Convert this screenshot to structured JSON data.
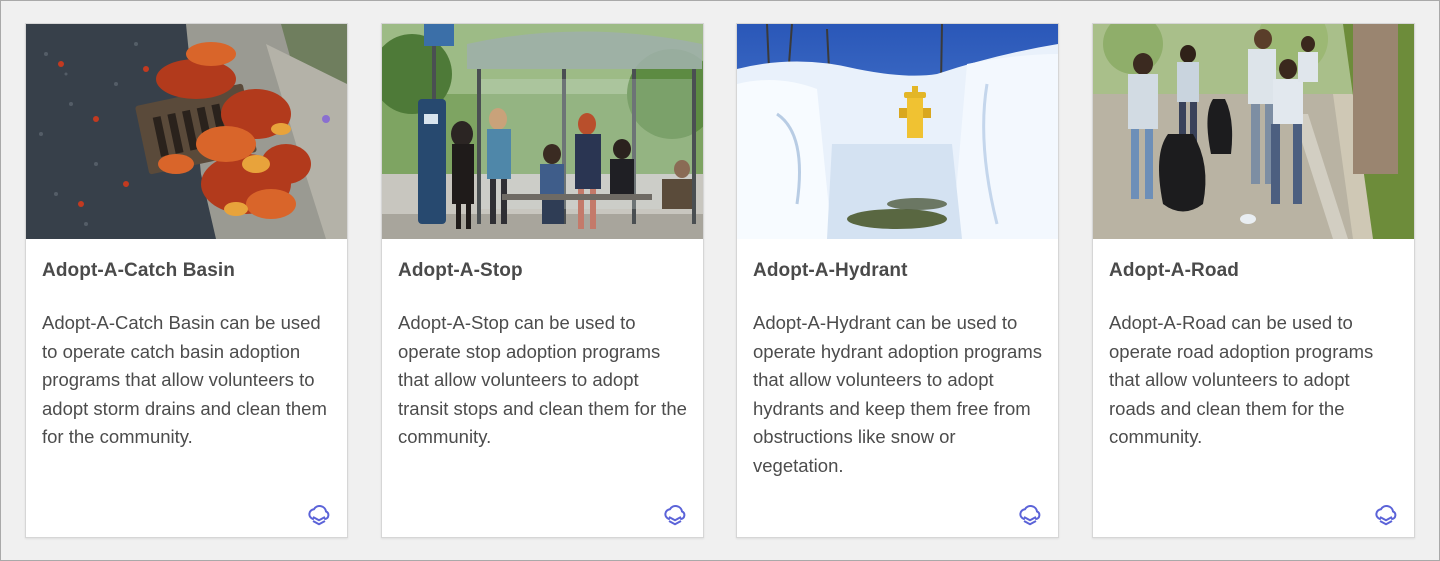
{
  "accent_color": "#5b63d8",
  "cards": [
    {
      "image": "storm-drain-with-autumn-leaves",
      "title": "Adopt-A-Catch Basin",
      "description": "Adopt-A-Catch Basin can be used to operate catch basin adoption programs that allow volunteers to adopt storm drains and clean them for the community.",
      "icon": "cloud-layers-icon"
    },
    {
      "image": "people-at-bus-stop-shelter",
      "title": "Adopt-A-Stop",
      "description": "Adopt-A-Stop can be used to operate stop adoption programs that allow volunteers to adopt transit stops and clean them for the community.",
      "icon": "cloud-layers-icon"
    },
    {
      "image": "fire-hydrant-in-snow",
      "title": "Adopt-A-Hydrant",
      "description": "Adopt-A-Hydrant can be used to operate hydrant adoption programs that allow volunteers to adopt hydrants and keep them free from obstructions like snow or vegetation.",
      "icon": "cloud-layers-icon"
    },
    {
      "image": "volunteers-picking-up-litter",
      "title": "Adopt-A-Road",
      "description": "Adopt-A-Road can be used to operate road adoption programs that allow volunteers to adopt roads and clean them for the community.",
      "icon": "cloud-layers-icon"
    }
  ]
}
